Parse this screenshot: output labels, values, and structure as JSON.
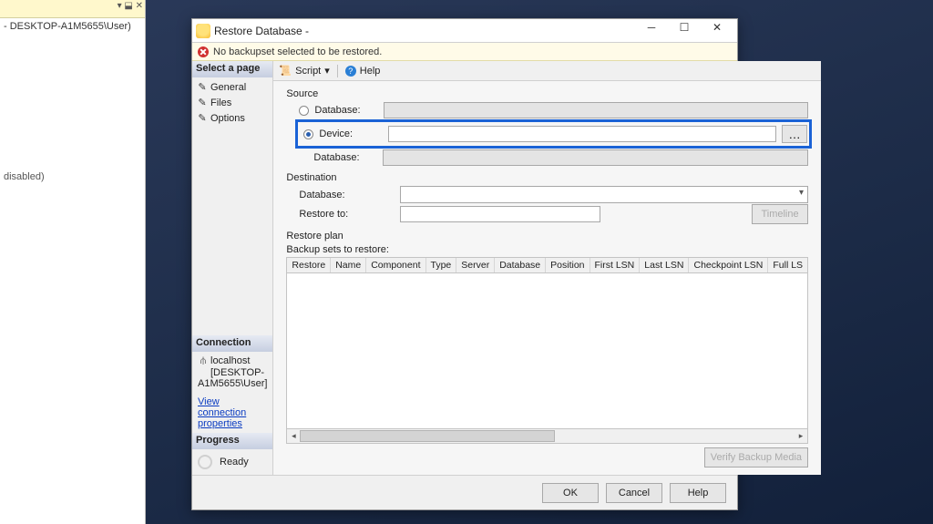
{
  "bg": {
    "toolbar_chars": "▾  ⬓  ✕",
    "crumb": "- DESKTOP-A1M5655\\User)",
    "disabled_text": "disabled)"
  },
  "dialog": {
    "title": "Restore Database -",
    "warning": "No backupset selected to be restored.",
    "sidebar": {
      "select_page": "Select a page",
      "pages": [
        "General",
        "Files",
        "Options"
      ],
      "connection_hdr": "Connection",
      "server": "localhost",
      "user": "[DESKTOP-A1M5655\\User]",
      "view_conn": "View connection properties",
      "progress_hdr": "Progress",
      "progress_txt": "Ready"
    },
    "toolbar": {
      "script": "Script",
      "help": "Help"
    },
    "source": {
      "title": "Source",
      "db_label": "Database:",
      "device_label": "Device:",
      "inner_db_label": "Database:"
    },
    "dest": {
      "title": "Destination",
      "db_label": "Database:",
      "restore_to_label": "Restore to:",
      "timeline_btn": "Timeline"
    },
    "plan": {
      "title": "Restore plan",
      "subtitle": "Backup sets to restore:",
      "cols": [
        "Restore",
        "Name",
        "Component",
        "Type",
        "Server",
        "Database",
        "Position",
        "First LSN",
        "Last LSN",
        "Checkpoint LSN",
        "Full LS"
      ]
    },
    "verify_btn": "Verify Backup Media",
    "footer": {
      "ok": "OK",
      "cancel": "Cancel",
      "help": "Help"
    }
  }
}
